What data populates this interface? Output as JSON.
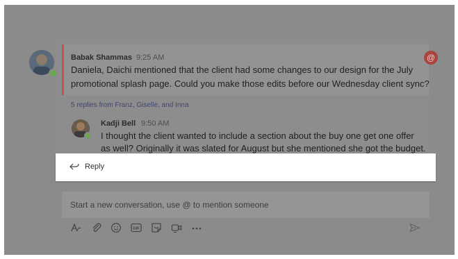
{
  "thread": {
    "post": {
      "author": "Babak Shammas",
      "time": "9:25 AM",
      "text_line1": "Daniela, Daichi mentioned that the client had some changes to our design for the July",
      "text_line2": "promotional splash page. Could you make those edits before our Wednesday client sync?",
      "mention_symbol": "@"
    },
    "replies_summary": "5 replies from Franz, Giselle, and Inna",
    "reply": {
      "author": "Kadji Bell",
      "time": "9:50 AM",
      "text_line1": "I thought the client wanted to include a section about the buy one get one offer",
      "text_line2": "as well? Originally it was slated for August but she mentioned she got the budget."
    },
    "reply_button_label": "Reply"
  },
  "composer": {
    "placeholder": "Start a new conversation, use @ to mention someone",
    "toolbar_icons": [
      "format-icon",
      "attach-icon",
      "emoji-icon",
      "gif-icon",
      "sticker-icon",
      "meet-now-icon",
      "more-options-icon"
    ],
    "send_icon": "send-icon"
  },
  "colors": {
    "overlay": "#8b8b8b",
    "accent_bar": "#c4514d",
    "mention_badge": "#a9443f",
    "presence": "#6aa84f"
  }
}
